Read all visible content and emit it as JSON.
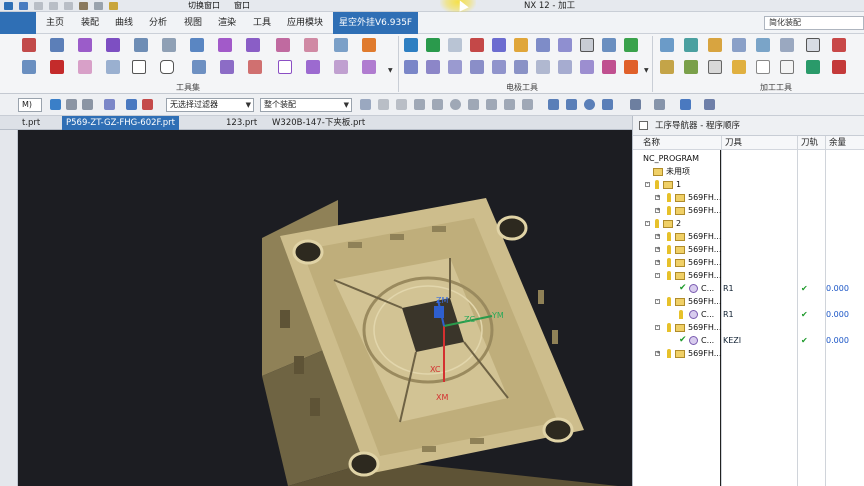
{
  "window": {
    "title": "NX 12 - 加工",
    "switch_window_label": "切换窗口",
    "window_label": "窗口"
  },
  "menu": {
    "tabs": [
      {
        "label": "主页"
      },
      {
        "label": "装配"
      },
      {
        "label": "曲线"
      },
      {
        "label": "分析"
      },
      {
        "label": "视图"
      },
      {
        "label": "渲染"
      },
      {
        "label": "工具"
      },
      {
        "label": "应用模块"
      },
      {
        "label": "星空外挂V6.935F"
      }
    ],
    "search_value": "简化装配"
  },
  "ribbon": {
    "groups": [
      {
        "label": "工具集"
      },
      {
        "label": "电极工具"
      },
      {
        "label": "加工工具"
      }
    ]
  },
  "filterbar": {
    "selection_filter": "无选择过滤器",
    "assembly_scope": "整个装配",
    "left_combo": "M)"
  },
  "file_tabs": [
    {
      "label": "t.prt"
    },
    {
      "label": "P569-ZT-GZ-FHG-602F.prt"
    },
    {
      "label": "123.prt"
    },
    {
      "label": "W320B-147-下夹板.prt"
    }
  ],
  "viewport": {
    "axis_labels": {
      "zm": "ZM",
      "zc": "ZC",
      "ym": "YM",
      "xc": "XC",
      "xm": "XM"
    },
    "colors": {
      "background": "#1c1d22",
      "part": "#cdbd8c",
      "part_shade": "#8f8157",
      "part_dark": "#5e5336"
    }
  },
  "navigator": {
    "title": "工序导航器 - 程序顺序",
    "columns": [
      "名称",
      "刀具",
      "刀轨",
      "余量"
    ],
    "rows": [
      {
        "name": "NC_PROGRAM",
        "tool": "",
        "path": "",
        "stock": ""
      },
      {
        "name": "未用项",
        "tool": "",
        "path": "",
        "stock": ""
      },
      {
        "name": "1",
        "tool": "",
        "path": "",
        "stock": ""
      },
      {
        "name": "569FH...",
        "tool": "",
        "path": "",
        "stock": ""
      },
      {
        "name": "569FH...",
        "tool": "",
        "path": "",
        "stock": ""
      },
      {
        "name": "2",
        "tool": "",
        "path": "",
        "stock": ""
      },
      {
        "name": "569FH...",
        "tool": "",
        "path": "",
        "stock": ""
      },
      {
        "name": "569FH...",
        "tool": "",
        "path": "",
        "stock": ""
      },
      {
        "name": "569FH...",
        "tool": "",
        "path": "",
        "stock": ""
      },
      {
        "name": "569FH...",
        "tool": "",
        "path": "",
        "stock": ""
      },
      {
        "name": "C...",
        "tool": "R1",
        "path": "✔",
        "stock": "0.000"
      },
      {
        "name": "569FH...",
        "tool": "",
        "path": "",
        "stock": ""
      },
      {
        "name": "C...",
        "tool": "R1",
        "path": "✔",
        "stock": "0.000"
      },
      {
        "name": "569FH...",
        "tool": "",
        "path": "",
        "stock": ""
      },
      {
        "name": "C...",
        "tool": "KEZI",
        "path": "✔",
        "stock": "0.000"
      },
      {
        "name": "569FH...",
        "tool": "",
        "path": "",
        "stock": ""
      }
    ]
  }
}
